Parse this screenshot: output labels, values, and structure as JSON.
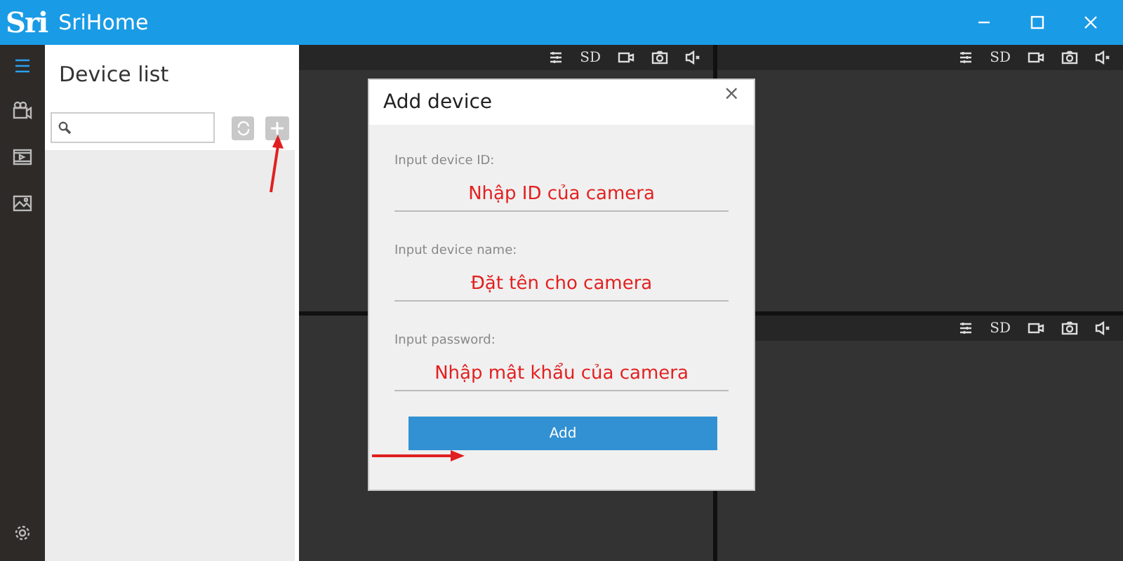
{
  "window": {
    "logo": "Sri",
    "title": "SriHome"
  },
  "nav": [
    {
      "selected": true
    },
    {
      "selected": false
    },
    {
      "selected": false
    },
    {
      "selected": false
    }
  ],
  "device_list": {
    "title": "Device list"
  },
  "video_panes": [
    {
      "toolbar": true,
      "quality": "SD"
    },
    {
      "toolbar": true,
      "quality": "SD"
    },
    {
      "toolbar": false
    },
    {
      "toolbar": true,
      "quality": "SD"
    }
  ],
  "dialog": {
    "title": "Add device",
    "close": "×",
    "fields": [
      {
        "label": "Input device ID:",
        "value": "Nhập ID của camera"
      },
      {
        "label": "Input device name:",
        "value": "Đặt tên cho camera"
      },
      {
        "label": "Input password:",
        "value": "Nhập mật khẩu của camera"
      }
    ],
    "button": "Add"
  }
}
